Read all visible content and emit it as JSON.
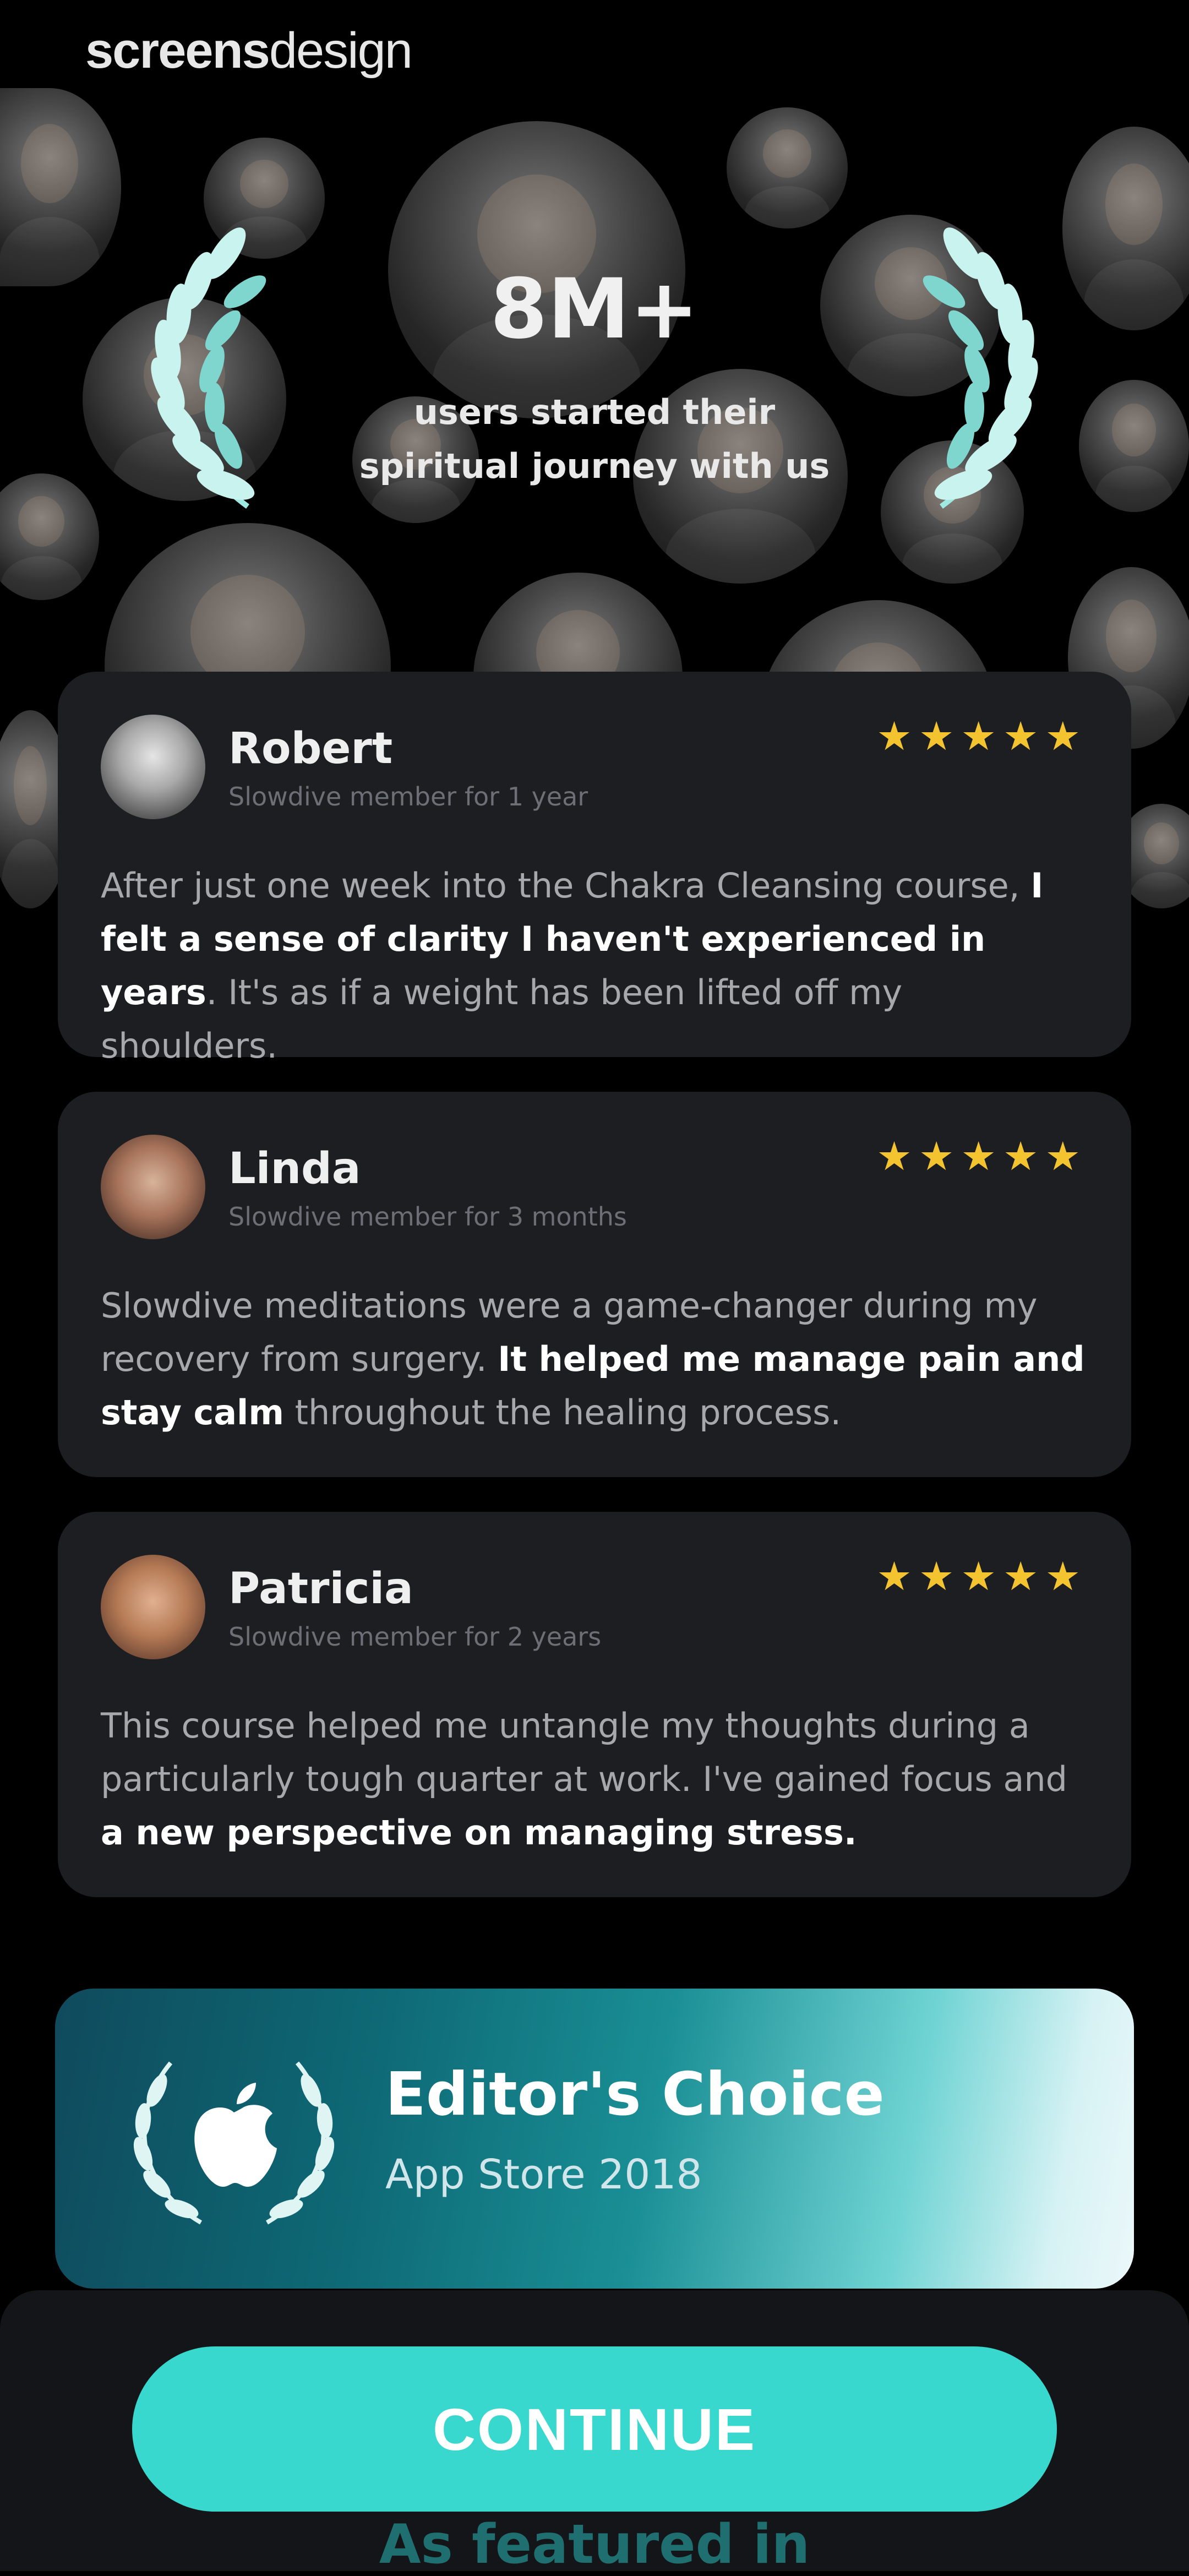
{
  "watermark": {
    "part1": "screens",
    "part2": "design"
  },
  "hero": {
    "stat": "8M+",
    "subtitle_line1": "users started their",
    "subtitle_line2": "spiritual journey with us"
  },
  "reviews": [
    {
      "name": "Robert",
      "member_since": "Slowdive member for 1 year",
      "stars": "★★★★★",
      "rating": 5,
      "text_before": "After just one week into the Chakra Cleansing course, ",
      "text_bold": "I felt a sense of clarity I haven't experienced in years",
      "text_after": ". It's as if a weight has been lifted off my shoulders."
    },
    {
      "name": "Linda",
      "member_since": "Slowdive member for 3 months",
      "stars": "★★★★★",
      "rating": 5,
      "text_before": "Slowdive meditations were a game-changer during my recovery from surgery. ",
      "text_bold": "It helped me manage pain and stay calm",
      "text_after": " throughout the healing process."
    },
    {
      "name": "Patricia",
      "member_since": "Slowdive member for 2 years",
      "stars": "★★★★★",
      "rating": 5,
      "text_before": "This course helped me untangle my thoughts during a particularly tough quarter at work. I've gained focus and ",
      "text_bold": "a new perspective on managing stress.",
      "text_after": ""
    }
  ],
  "editor_choice": {
    "title": "Editor's Choice",
    "subtitle": "App Store 2018"
  },
  "cta": {
    "label": "CONTINUE"
  },
  "featured": {
    "label": "As featured in"
  },
  "colors": {
    "accent": "#39d8cf",
    "star": "#f4c430",
    "card": "#1c1e22",
    "laurel": "#8fe6e0"
  }
}
